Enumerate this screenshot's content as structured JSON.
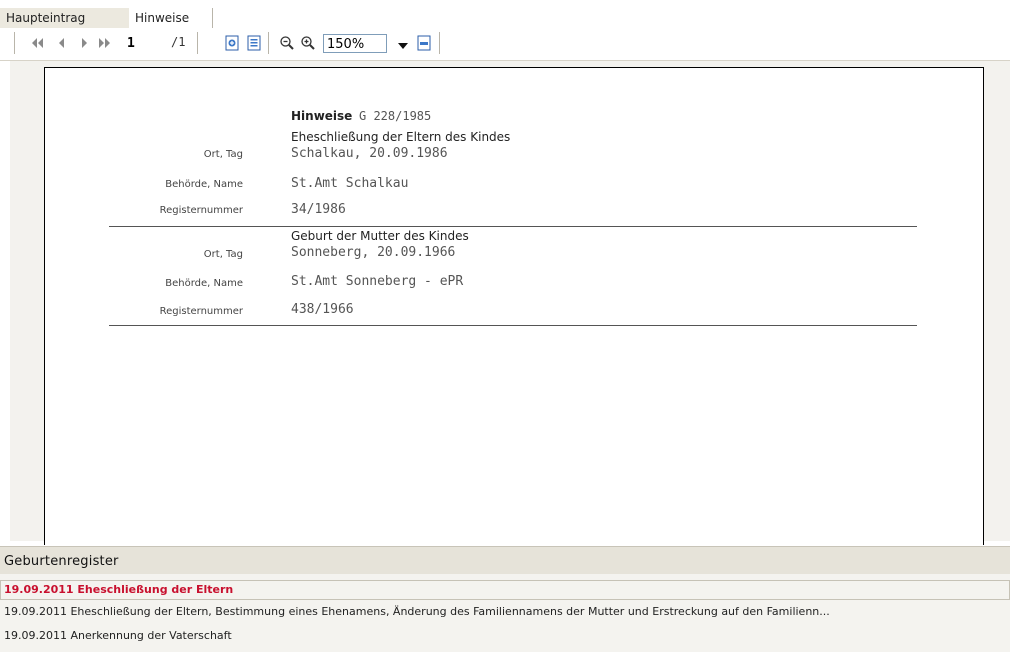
{
  "tabs": [
    {
      "label": "Haupteintrag"
    },
    {
      "label": "Hinweise"
    }
  ],
  "toolbar": {
    "page_current": "1",
    "page_total": "/1",
    "zoom": "150%"
  },
  "document": {
    "heading_bold": "Hinweise",
    "heading_ref": "G 228/1985",
    "sections": [
      {
        "title": "Eheschließung der Eltern des Kindes",
        "rows": [
          {
            "label": "Ort, Tag",
            "value": "Schalkau, 20.09.1986"
          },
          {
            "label": "Behörde, Name",
            "value": "St.Amt Schalkau"
          },
          {
            "label": "Registernummer",
            "value": "34/1986"
          }
        ]
      },
      {
        "title": "Geburt der Mutter des Kindes",
        "rows": [
          {
            "label": "Ort, Tag",
            "value": "Sonneberg, 20.09.1966"
          },
          {
            "label": "Behörde, Name",
            "value": "St.Amt Sonneberg - ePR"
          },
          {
            "label": "Registernummer",
            "value": "438/1966"
          }
        ]
      }
    ]
  },
  "panel": {
    "title": "Geburtenregister",
    "items": [
      {
        "text": "19.09.2011 Eheschließung der Eltern"
      },
      {
        "text": "19.09.2011 Eheschließung der Eltern, Bestimmung eines Ehenamens, Änderung des Familiennamens der Mutter und Erstreckung auf den Familienn..."
      },
      {
        "text": "19.09.2011 Anerkennung der Vaterschaft"
      }
    ]
  },
  "colors": {
    "selected_text": "#c8102e",
    "panel_header": "#e6e3d9",
    "tab_inactive": "#ece9df"
  }
}
